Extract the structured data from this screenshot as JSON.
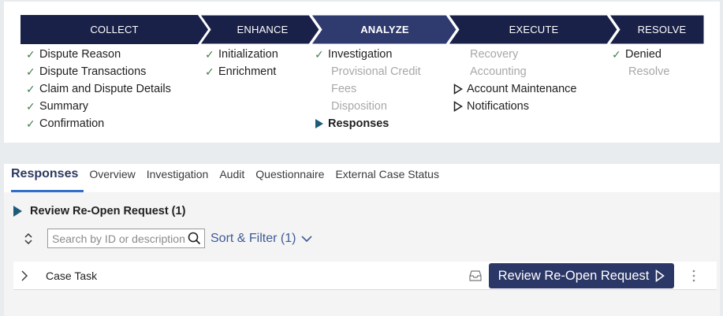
{
  "stages": [
    {
      "label": "COLLECT",
      "active": false,
      "color": "#1a2148"
    },
    {
      "label": "ENHANCE",
      "active": false,
      "color": "#1a2148"
    },
    {
      "label": "ANALYZE",
      "active": true,
      "color": "#2f3a6e"
    },
    {
      "label": "EXECUTE",
      "active": false,
      "color": "#1a2148"
    },
    {
      "label": "RESOLVE",
      "active": false,
      "color": "#1a2148"
    }
  ],
  "steps": {
    "collect": [
      {
        "label": "Dispute Reason",
        "status": "done"
      },
      {
        "label": "Dispute Transactions",
        "status": "done"
      },
      {
        "label": "Claim and Dispute Details",
        "status": "done"
      },
      {
        "label": "Summary",
        "status": "done"
      },
      {
        "label": "Confirmation",
        "status": "done"
      }
    ],
    "enhance": [
      {
        "label": "Initialization",
        "status": "done"
      },
      {
        "label": "Enrichment",
        "status": "done"
      }
    ],
    "analyze": [
      {
        "label": "Investigation",
        "status": "done"
      },
      {
        "label": "Provisional Credit",
        "status": "pending"
      },
      {
        "label": "Fees",
        "status": "pending"
      },
      {
        "label": "Disposition",
        "status": "pending"
      },
      {
        "label": "Responses",
        "status": "current"
      }
    ],
    "execute": [
      {
        "label": "Recovery",
        "status": "pending"
      },
      {
        "label": "Accounting",
        "status": "pending"
      },
      {
        "label": "Account Maintenance",
        "status": "arrow"
      },
      {
        "label": "Notifications",
        "status": "arrow"
      }
    ],
    "resolve": [
      {
        "label": "Denied",
        "status": "done"
      },
      {
        "label": "Resolve",
        "status": "pending"
      }
    ]
  },
  "tabs": [
    {
      "label": "Responses",
      "active": true
    },
    {
      "label": "Overview",
      "active": false
    },
    {
      "label": "Investigation",
      "active": false
    },
    {
      "label": "Audit",
      "active": false
    },
    {
      "label": "Questionnaire",
      "active": false
    },
    {
      "label": "External Case Status",
      "active": false
    }
  ],
  "section": {
    "title": "Review Re-Open Request (1)"
  },
  "search": {
    "placeholder": "Search by ID or description"
  },
  "sort_filter": {
    "label": "Sort & Filter (1)"
  },
  "case_row": {
    "label": "Case Task",
    "action_label": "Review Re-Open Request"
  },
  "colors": {
    "accent": "#2f6ec9",
    "check": "#3f7d4e",
    "button": "#2b3766",
    "link": "#3d5a96"
  }
}
